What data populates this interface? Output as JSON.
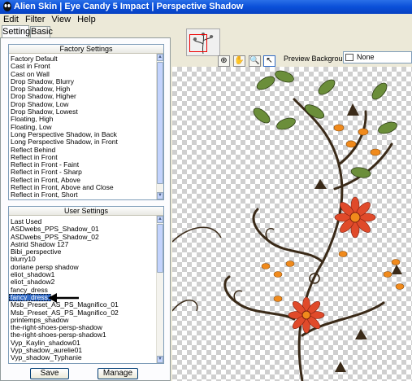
{
  "window": {
    "title": "Alien Skin | Eye Candy 5 Impact | Perspective Shadow"
  },
  "menu": [
    "Edit",
    "Filter",
    "View",
    "Help"
  ],
  "tabs": {
    "settings": "Settings",
    "basic": "Basic"
  },
  "factory": {
    "header": "Factory Settings",
    "items": [
      "Factory Default",
      "Cast in Front",
      "Cast on Wall",
      "Drop Shadow, Blurry",
      "Drop Shadow, High",
      "Drop Shadow, Higher",
      "Drop Shadow, Low",
      "Drop Shadow, Lowest",
      "Floating, High",
      "Floating, Low",
      "Long Perspective Shadow, in Back",
      "Long Perspective Shadow, in Front",
      "Reflect Behind",
      "Reflect in Front",
      "Reflect in Front - Faint",
      "Reflect in Front - Sharp",
      "Reflect in Front, Above",
      "Reflect in Front, Above and Close",
      "Reflect in Front, Short"
    ]
  },
  "user": {
    "header": "User Settings",
    "items": [
      "Last Used",
      "ASDwebs_PPS_Shadow_01",
      "ASDwebs_PPS_Shadow_02",
      "Astrid Shadow 127",
      "Bibi_perspective",
      "blurry10",
      "doriane persp shadow",
      "eliot_shadow1",
      "eliot_shadow2",
      "fancy_dress",
      "fancy_dress 2",
      "Msb_Preset_AS_PS_Magnifico_01",
      "Msb_Preset_AS_PS_Magnifico_02",
      "printemps_shadow",
      "the-right-shoes-persp-shadow",
      "the-right-shoes-persp-shadow1",
      "Vyp_Kaylin_shadow01",
      "Vyp_shadow_aurelie01",
      "Vyp_shadow_Typhanie"
    ],
    "selected_index": 10
  },
  "buttons": {
    "save": "Save",
    "manage": "Manage"
  },
  "preview": {
    "label": "Preview Background:",
    "value": "None"
  },
  "colors": {
    "leaf": "#6b8e3a",
    "flower_red": "#e04a2a",
    "flower_orange": "#f08a1c",
    "stem": "#3a2a18",
    "selection": "#316ac5"
  }
}
